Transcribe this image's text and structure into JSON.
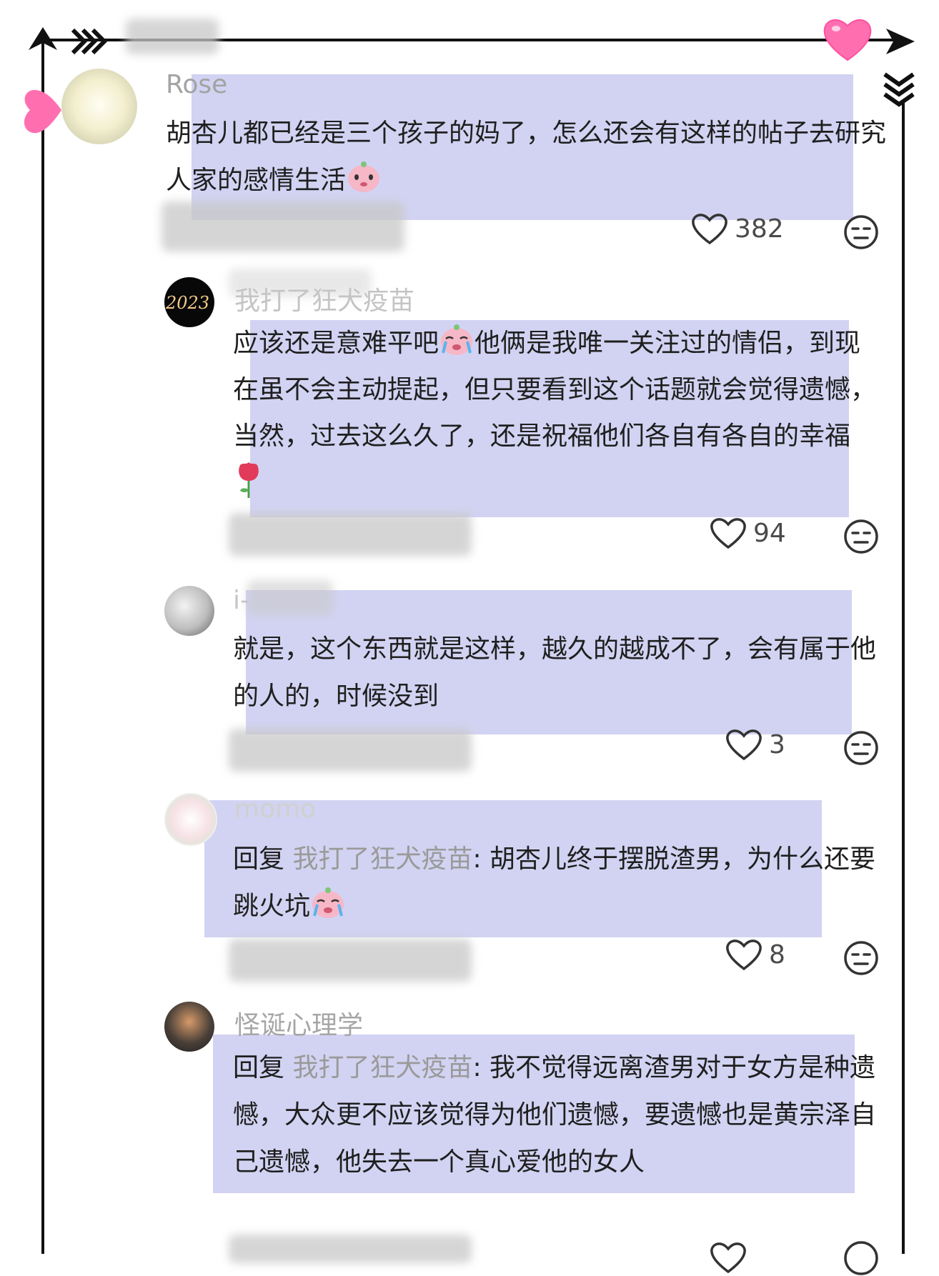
{
  "colors": {
    "highlight": "#d2d3f2",
    "frame": "#111111",
    "heart_pink": "#ff6fb0"
  },
  "comments": [
    {
      "username": "Rose",
      "text": "胡杏儿都已经是三个孩子的妈了，怎么还会有这样的帖子去研究人家的感情生活",
      "emoji": "blushing-face-icon",
      "likes": "382"
    },
    {
      "username": "我打了狂犬疫苗",
      "text_a": "应该还是意难平吧",
      "text_b": "他俩是我唯一关注过的情侣，到现在虽不会主动提起，但只要看到这个话题就会觉得遗憾，当然，过去这么久了，还是祝福他们各自有各自的幸福",
      "emoji_a": "crying-face-icon",
      "emoji_b": "rose-icon",
      "likes": "94"
    },
    {
      "username": "i-",
      "text": "就是，这个东西就是这样，越久的越成不了，会有属于他的人的，时候没到",
      "likes": "3"
    },
    {
      "username": "momo",
      "reply_prefix": "回复",
      "reply_target": "我打了狂犬疫苗",
      "text": ": 胡杏儿终于摆脱渣男，为什么还要跳火坑",
      "emoji": "crying-face-icon",
      "likes": "8"
    },
    {
      "username": "怪诞心理学",
      "reply_prefix": "回复",
      "reply_target": "我打了狂犬疫苗",
      "text": ": 我不觉得远离渣男对于女方是种遗憾，大众更不应该觉得为他们遗憾，要遗憾也是黄宗泽自己遗憾，他失去一个真心爱他的女人"
    }
  ]
}
